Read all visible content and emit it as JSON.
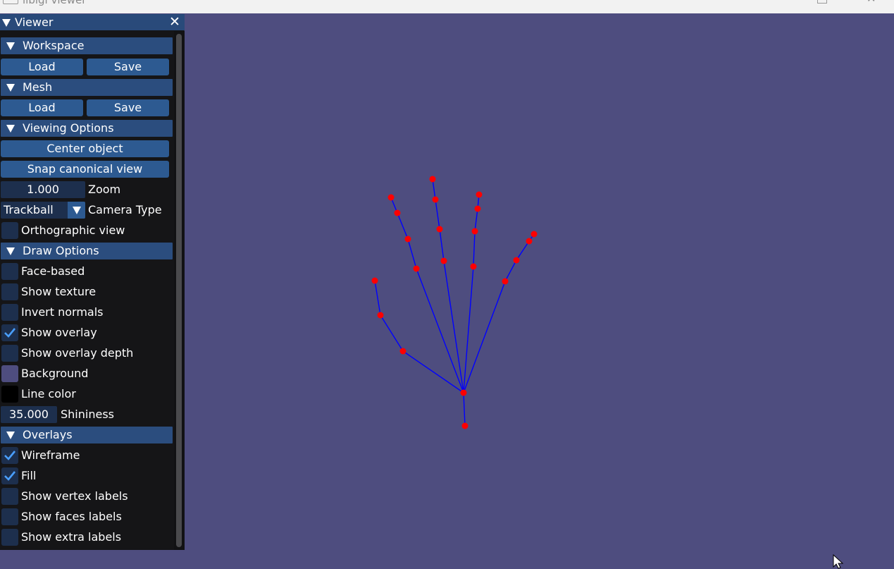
{
  "window": {
    "title": "libigl viewer"
  },
  "panel": {
    "title": "Viewer",
    "sections": {
      "workspace": {
        "label": "Workspace",
        "load": "Load",
        "save": "Save"
      },
      "mesh": {
        "label": "Mesh",
        "load": "Load",
        "save": "Save"
      },
      "viewing": {
        "label": "Viewing Options",
        "center": "Center object",
        "snap": "Snap canonical view",
        "zoom_value": "1.000",
        "zoom_label": "Zoom",
        "camera_value": "Trackball",
        "camera_label": "Camera Type",
        "ortho_label": "Orthographic view"
      },
      "draw": {
        "label": "Draw Options",
        "face_based": "Face-based",
        "show_texture": "Show texture",
        "invert_normals": "Invert normals",
        "show_overlay": "Show overlay",
        "show_overlay_depth": "Show overlay depth",
        "background": "Background",
        "line_color": "Line color",
        "shininess_value": "35.000",
        "shininess_label": "Shininess"
      },
      "overlays": {
        "label": "Overlays",
        "wireframe": "Wireframe",
        "fill": "Fill",
        "vertex_labels": "Show vertex labels",
        "faces_labels": "Show faces labels",
        "extra_labels": "Show extra labels"
      }
    },
    "checkboxes": {
      "orthographic": false,
      "face_based": false,
      "show_texture": false,
      "invert_normals": false,
      "show_overlay": true,
      "show_overlay_depth": false,
      "wireframe": true,
      "fill": true,
      "vertex_labels": false,
      "faces_labels": false,
      "extra_labels": false
    }
  },
  "colors": {
    "viewport_background": "#4e4d7f",
    "background_swatch": "#4e4d7f",
    "line_color_swatch": "#000000",
    "skeleton_edge": "#0000ff",
    "skeleton_joint": "#ff0000",
    "accent": "#2d5a91",
    "check": "#4a9fff"
  },
  "icons": {
    "collapse": "triangle-down-icon",
    "close": "close-icon",
    "check": "checkmark-icon",
    "cursor": "mouse-pointer-icon"
  }
}
